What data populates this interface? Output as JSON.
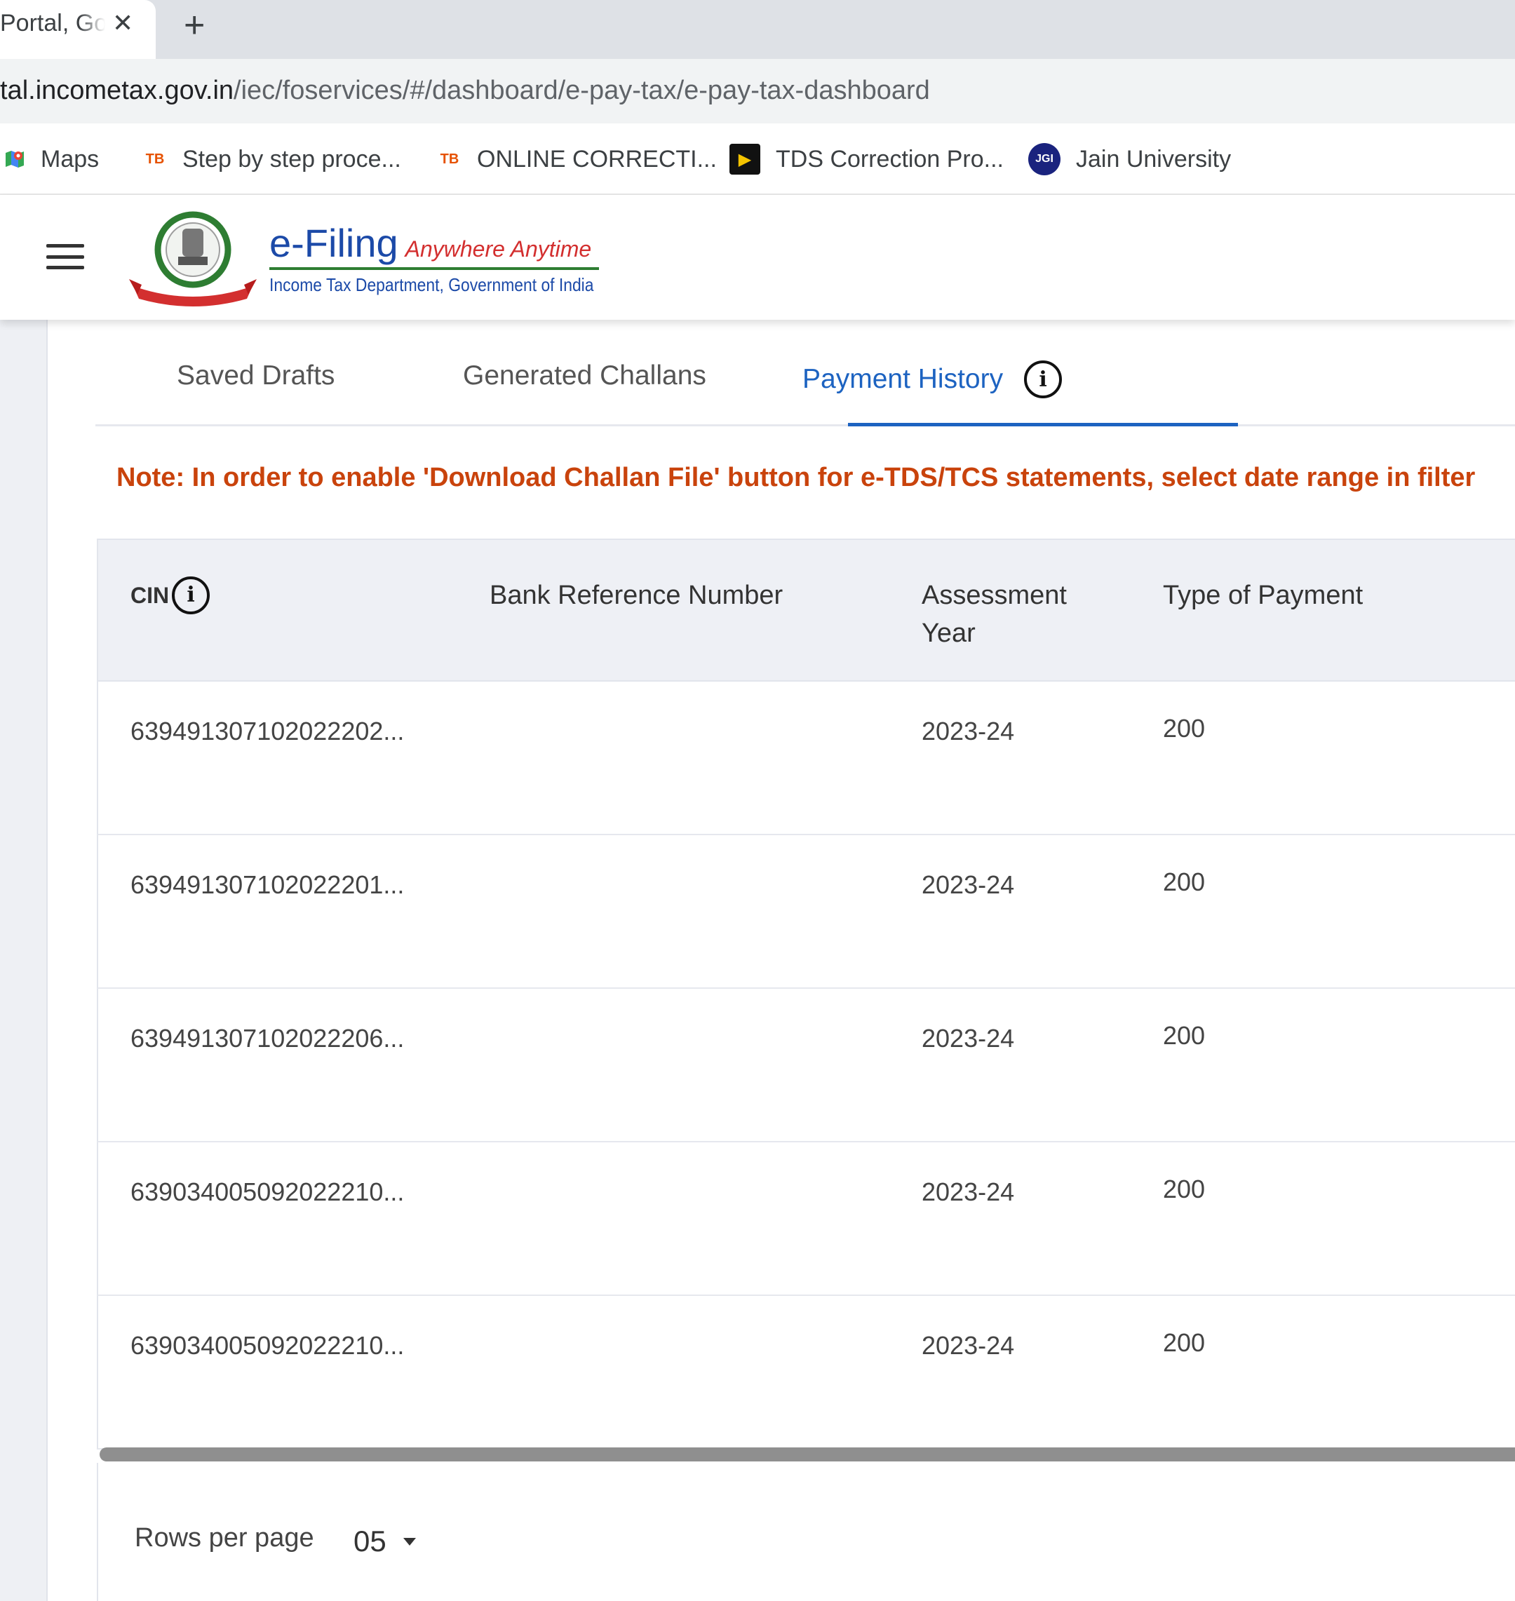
{
  "browser": {
    "tab_title": "Portal, Gov",
    "tab_close": "✕",
    "new_tab": "+",
    "url_domain": "tal.incometax.gov.in",
    "url_path": "/iec/foservices/#/dashboard/e-pay-tax/e-pay-tax-dashboard"
  },
  "bookmarks": [
    {
      "label": "Maps",
      "icon": "maps-icon"
    },
    {
      "label": "Step by step proce...",
      "icon": "tb-icon",
      "icon_text": "TB"
    },
    {
      "label": "ONLINE CORRECTI...",
      "icon": "tb-icon",
      "icon_text": "TB"
    },
    {
      "label": "TDS Correction Pro...",
      "icon": "play-icon",
      "icon_text": "▶"
    },
    {
      "label": "Jain University",
      "icon": "jgi-icon",
      "icon_text": "JGI"
    }
  ],
  "header": {
    "brand_main": "e-Filing",
    "brand_tag": "Anywhere Anytime",
    "brand_sub": "Income Tax Department, Government of India"
  },
  "tabs": {
    "saved_drafts": "Saved Drafts",
    "generated_challans": "Generated Challans",
    "payment_history": "Payment History",
    "active": "payment_history"
  },
  "note": "Note: In order to enable 'Download Challan File' button for e-TDS/TCS statements, select date range in filter",
  "table": {
    "columns": {
      "cin": "CIN",
      "bank_ref": "Bank Reference Number",
      "ay": "Assessment Year",
      "type": "Type of Payment"
    },
    "rows": [
      {
        "cin": "639491307102022202...",
        "bank_ref": "",
        "ay": "2023-24",
        "type": "200"
      },
      {
        "cin": "639491307102022201...",
        "bank_ref": "",
        "ay": "2023-24",
        "type": "200"
      },
      {
        "cin": "639491307102022206...",
        "bank_ref": "",
        "ay": "2023-24",
        "type": "200"
      },
      {
        "cin": "639034005092022210...",
        "bank_ref": "",
        "ay": "2023-24",
        "type": "200"
      },
      {
        "cin": "639034005092022210...",
        "bank_ref": "",
        "ay": "2023-24",
        "type": "200"
      }
    ]
  },
  "pagination": {
    "rows_per_page_label": "Rows per page",
    "rows_per_page_value": "05"
  },
  "colors": {
    "accent": "#1d63c1",
    "note": "#c9430c",
    "header_bg": "#eef0f5"
  }
}
